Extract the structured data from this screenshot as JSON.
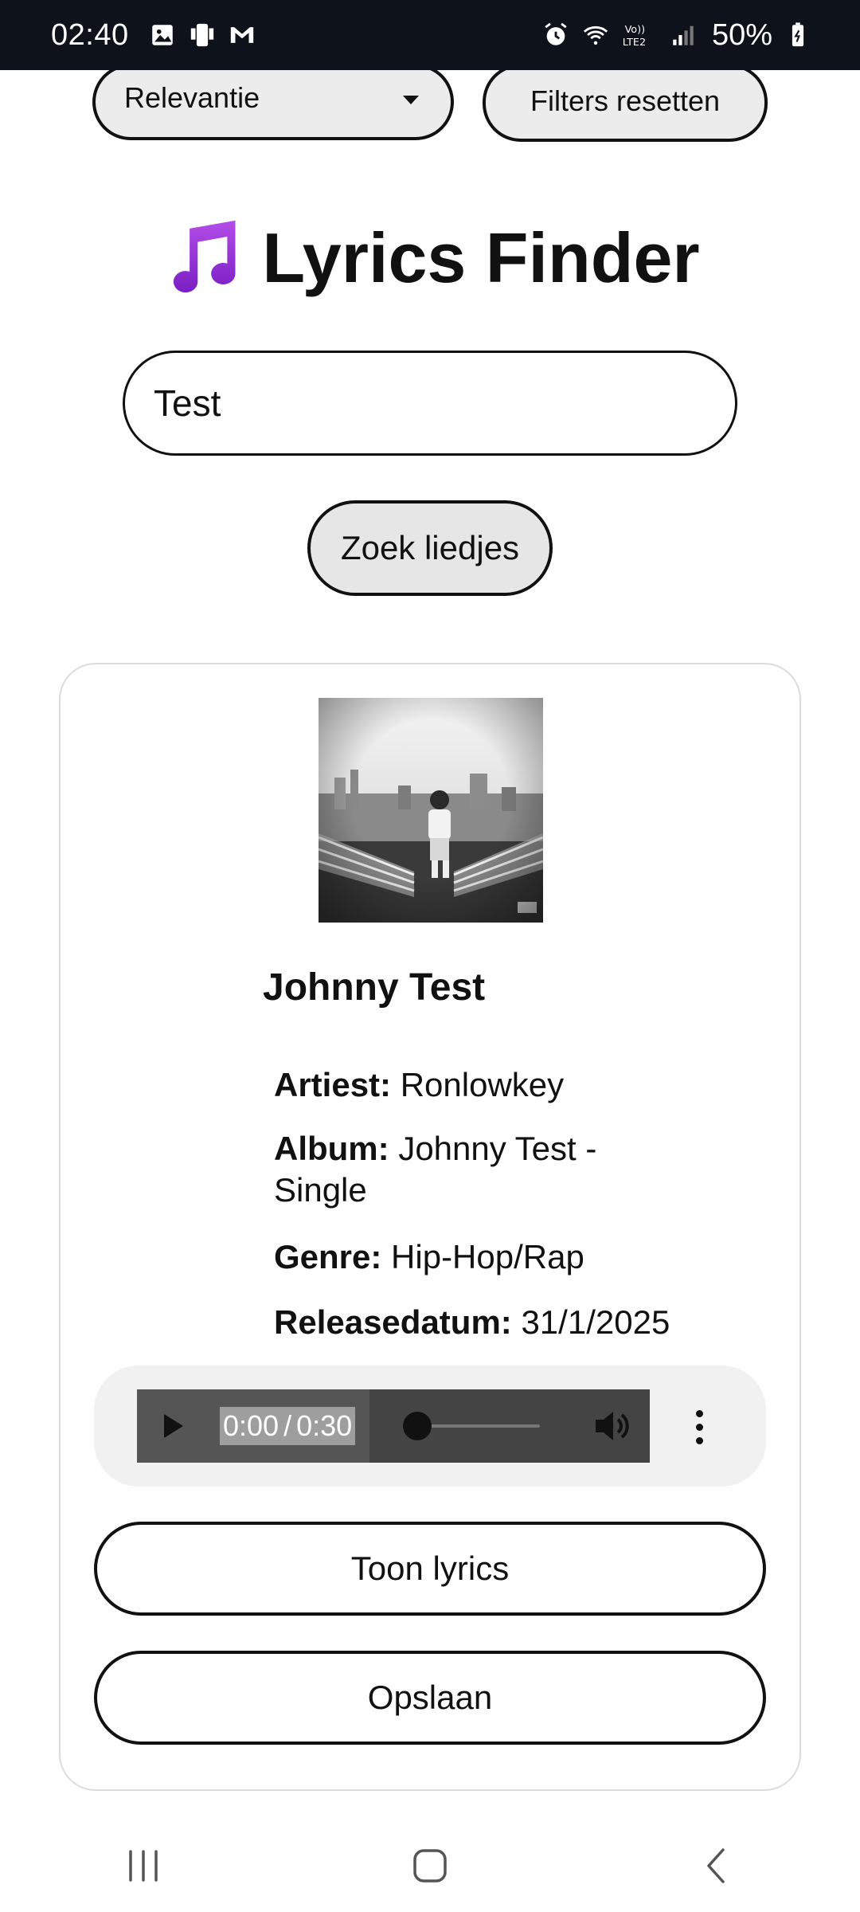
{
  "status_bar": {
    "time": "02:40",
    "battery": "50%",
    "icons_left": [
      "image-icon",
      "phone-sync-icon",
      "gmail-icon"
    ],
    "icons_right": [
      "alarm-icon",
      "wifi-icon",
      "volte-icon",
      "signal-icon",
      "battery-icon"
    ],
    "volte_label": "VoLTE2"
  },
  "filters": {
    "sort_label": "Relevantie",
    "reset_label": "Filters resetten"
  },
  "header": {
    "title": "Lyrics Finder",
    "icon": "music-note-icon",
    "icon_color": "#8b2bd6"
  },
  "search": {
    "value": "Test",
    "button_label": "Zoek liedjes"
  },
  "result": {
    "title": "Johnny Test",
    "artist_label": "Artiest:",
    "artist": "Ronlowkey",
    "album_label": "Album:",
    "album": "Johnny Test - Single",
    "genre_label": "Genre:",
    "genre": "Hip-Hop/Rap",
    "release_label": "Releasedatum:",
    "release": "31/1/2025",
    "audio": {
      "current": "0:00",
      "separator": "/",
      "duration": "0:30"
    },
    "lyrics_button": "Toon lyrics",
    "save_button": "Opslaan"
  },
  "nav": {
    "items": [
      "recent-apps-icon",
      "home-icon",
      "back-icon"
    ]
  }
}
